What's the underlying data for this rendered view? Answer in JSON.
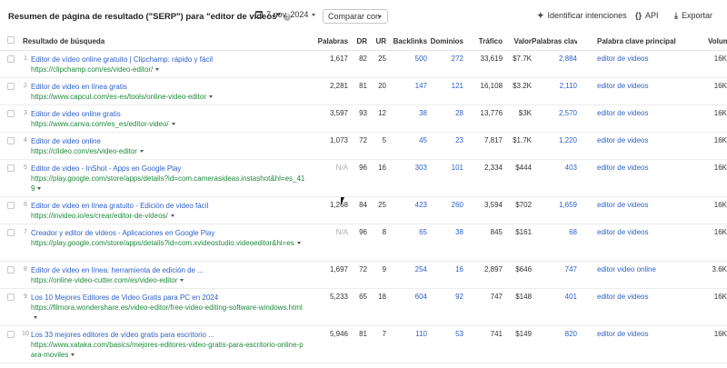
{
  "header": {
    "title": "Resumen de página de resultado (\"SERP\") para \"editor de videos\"",
    "help_icon": "?",
    "date": "7 nov. 2024",
    "compare_label": "Comparar con",
    "identify_label": "Identificar intenciones",
    "api_label": "API",
    "api_icon": "{}",
    "export_label": "Exportar"
  },
  "columns": {
    "result": "Resultado de búsqueda",
    "words": "Palabras",
    "dr": "DR",
    "ur": "UR",
    "backlinks": "Backlinks",
    "domains": "Dominios",
    "traffic": "Tráfico",
    "value": "Valor",
    "keywords": "Palabras clave",
    "main_keyword": "Palabra clave principal",
    "volume": "Volumen"
  },
  "rows": [
    {
      "n": "1",
      "title": "Editor de vídeo online gratuito | Clipchamp: rápido y fácil",
      "url": "https://clipchamp.com/es/video-editor/",
      "words": "1,617",
      "dr": "82",
      "ur": "25",
      "backlinks": "500",
      "domains": "272",
      "traffic": "33,619",
      "value": "$7.7K",
      "keywords": "2,884",
      "main_kw": "editor de videos",
      "volume": "16K"
    },
    {
      "n": "2",
      "title": "Editor de video en línea gratis",
      "url": "https://www.capcut.com/es-es/tools/online-video-editor",
      "words": "2,281",
      "dr": "81",
      "ur": "20",
      "backlinks": "147",
      "domains": "121",
      "traffic": "16,108",
      "value": "$3.2K",
      "keywords": "2,110",
      "main_kw": "editor de videos",
      "volume": "16K"
    },
    {
      "n": "3",
      "title": "Editor de video online gratis",
      "url": "https://www.canva.com/es_es/editor-video/",
      "words": "3,597",
      "dr": "93",
      "ur": "12",
      "backlinks": "38",
      "domains": "28",
      "traffic": "13,776",
      "value": "$3K",
      "keywords": "2,570",
      "main_kw": "editor de videos",
      "volume": "16K"
    },
    {
      "n": "4",
      "title": "Editor de video online",
      "url": "https://clideo.com/es/video-editor",
      "words": "1,073",
      "dr": "72",
      "ur": "5",
      "backlinks": "45",
      "domains": "23",
      "traffic": "7,817",
      "value": "$1.7K",
      "keywords": "1,220",
      "main_kw": "editor de videos",
      "volume": "16K"
    },
    {
      "n": "5",
      "title": "Editor de video - InShot - Apps en Google Play",
      "url": "https://play.google.com/store/apps/details?id=com.camerasideas.instashot&hl=es_419",
      "words": "N/A",
      "dr": "96",
      "ur": "16",
      "backlinks": "303",
      "domains": "101",
      "traffic": "2,334",
      "value": "$444",
      "keywords": "403",
      "main_kw": "editor de videos",
      "volume": "16K"
    },
    {
      "n": "6",
      "title": "Editor de video en línea gratuito - Edición de video fácil",
      "url": "https://invideo.io/es/crear/editor-de-videos/",
      "words": "1,268",
      "dr": "84",
      "ur": "25",
      "backlinks": "423",
      "domains": "260",
      "traffic": "3,594",
      "value": "$702",
      "keywords": "1,659",
      "main_kw": "editor de videos",
      "volume": "16K"
    },
    {
      "n": "7",
      "title": "Creador y editor de videos - Aplicaciones en Google Play",
      "url": "https://play.google.com/store/apps/details?id=com.xvideostudio.videoeditor&hl=es",
      "words": "N/A",
      "dr": "96",
      "ur": "8",
      "backlinks": "65",
      "domains": "38",
      "traffic": "845",
      "value": "$161",
      "keywords": "68",
      "main_kw": "editor de videos",
      "volume": "16K"
    },
    {
      "n": "8",
      "title": "Editor de video en línea: herramienta de edición de ...",
      "url": "https://online-video-cutter.com/es/video-editor",
      "words": "1,697",
      "dr": "72",
      "ur": "9",
      "backlinks": "254",
      "domains": "16",
      "traffic": "2,897",
      "value": "$646",
      "keywords": "747",
      "main_kw": "editor video online",
      "volume": "3.6K"
    },
    {
      "n": "9",
      "title": "Los 10 Mejores Editores de Video Gratis para PC en 2024",
      "url": "https://filmora.wondershare.es/video-editor/free-video-editing-software-windows.html",
      "words": "5,233",
      "dr": "65",
      "ur": "18",
      "backlinks": "604",
      "domains": "92",
      "traffic": "747",
      "value": "$148",
      "keywords": "401",
      "main_kw": "editor de videos",
      "volume": "16K"
    },
    {
      "n": "10",
      "title": "Los 33 mejores editores de vídeo gratis para escritorio ...",
      "url": "https://www.xataka.com/basics/mejores-editores-video-gratis-para-escritorio-online-para-moviles",
      "words": "5,946",
      "dr": "81",
      "ur": "7",
      "backlinks": "110",
      "domains": "53",
      "traffic": "741",
      "value": "$149",
      "keywords": "820",
      "main_kw": "editor de videos",
      "volume": "16K"
    }
  ],
  "colors": {
    "link": "#2f60c8",
    "url": "#1e8a3e",
    "muted": "#aaaaaa"
  },
  "icons": [
    "help-icon",
    "calendar-icon",
    "chevron-down-icon",
    "sparkle-icon",
    "api-icon",
    "download-icon",
    "checkbox-icon",
    "caret-down-icon"
  ]
}
